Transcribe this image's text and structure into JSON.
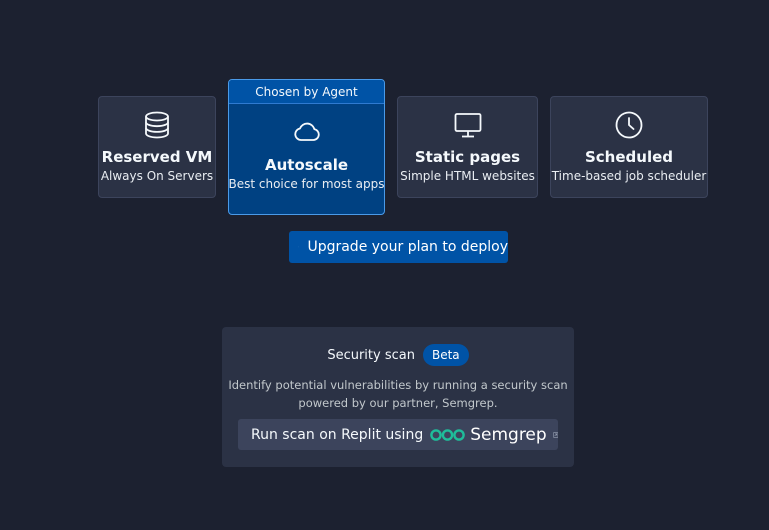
{
  "deployment_options": [
    {
      "title": "Reserved VM",
      "subtitle": "Always On Servers",
      "icon": "database-icon"
    },
    {
      "title": "Autoscale",
      "subtitle": "Best choice for most apps",
      "icon": "cloud-icon",
      "selected": true,
      "chosen_label": "Chosen by Agent"
    },
    {
      "title": "Static pages",
      "subtitle": "Simple HTML websites",
      "icon": "monitor-icon"
    },
    {
      "title": "Scheduled",
      "subtitle": "Time-based job scheduler",
      "icon": "clock-icon"
    }
  ],
  "upgrade_button": {
    "label": "Upgrade your plan to deploy",
    "icon": "sparkle-icon"
  },
  "security_scan": {
    "title": "Security scan",
    "badge": "Beta",
    "description_line1": "Identify potential vulnerabilities by running a security scan",
    "description_line2": "powered by our partner, Semgrep.",
    "run_button_label": "Run scan on Replit using",
    "partner_name": "Semgrep",
    "partner_icon": "semgrep-logo-icon",
    "external_icon": "external-link-icon"
  },
  "colors": {
    "background": "#1c2130",
    "card": "#2b3245",
    "card_border": "#3c445c",
    "selected_card": "#004182",
    "selected_border": "#4a9ae8",
    "accent": "#0053a6",
    "semgrep_green": "#1fbd9a"
  }
}
